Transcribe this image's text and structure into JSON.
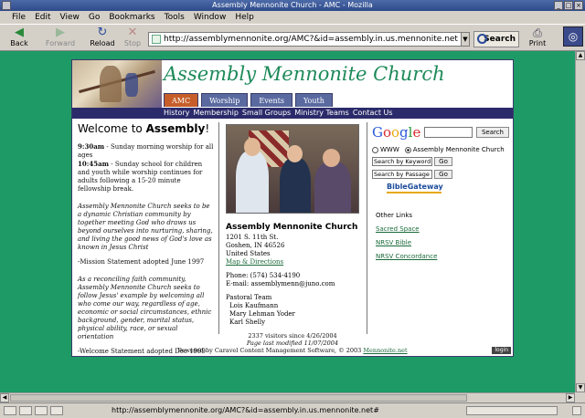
{
  "window": {
    "title": "Assembly Mennonite Church - AMC - Mozilla"
  },
  "menu": [
    "File",
    "Edit",
    "View",
    "Go",
    "Bookmarks",
    "Tools",
    "Window",
    "Help"
  ],
  "toolbar": {
    "back": "Back",
    "forward": "Forward",
    "reload": "Reload",
    "stop": "Stop",
    "url": "http://assemblymennonite.org/AMC?&id=assembly.in.us.mennonite.net",
    "search": "Search",
    "print": "Print"
  },
  "status": {
    "text": "http://assemblymennonite.org/AMC?&id=assembly.in.us.mennonite.net#"
  },
  "site": {
    "title": "Assembly Mennonite Church",
    "tabs": [
      "AMC",
      "Worship",
      "Events",
      "Youth"
    ],
    "subnav": [
      "History",
      "Membership",
      "Small Groups",
      "Ministry Teams",
      "Contact Us"
    ],
    "welcome_prefix": "Welcome to ",
    "welcome_bold": "Assembly",
    "welcome_suffix": "!",
    "schedule_time1": "9:30am",
    "schedule_text1": " - Sunday morning worship for all ages",
    "schedule_time2": "10:45am",
    "schedule_text2": " - Sunday school for children and youth while worship continues for adults following a 15-20 minute fellowship break.",
    "mission": "Assembly Mennonite Church seeks to be a dynamic Christian community by together meeting God who draws us beyond ourselves into nurturing, sharing, and living the good news of God's love as known in Jesus Christ",
    "mission_note": "-Mission Statement adopted June 1997",
    "welcome_statement": "As a reconciling faith community, Assembly Mennonite Church seeks to follow Jesus' example by welcoming all who come our way, regardless of age, economic or social circumstances, ethnic background, gender, marital status, physical ability, race, or sexual orientation",
    "welcome_note": "-Welcome Statement adopted Dec 1999",
    "church_name": "Assembly Mennonite Church",
    "addr1": "1201 S. 11th St.",
    "addr2": "Goshen, IN 46526",
    "addr3": "United States",
    "map_link": "Map & Directions",
    "phone": "Phone: (574) 534-4190",
    "email": "E-mail: assemblymenn@juno.com",
    "team_title": "Pastoral Team",
    "team": [
      "Lois Kaufmann",
      "Mary Lehman Yoder",
      "Karl Shelly"
    ],
    "search_btn": "Search",
    "radio_www": "WWW",
    "radio_site": "Assembly Mennonite Church",
    "bible_keyword": "Search by Keyword",
    "bible_passage": "Search by Passage",
    "go": "Go",
    "biblegateway": "BibleGateway",
    "other_links": "Other Links",
    "link1": "Sacred Space",
    "link2": "NRSV Bible",
    "link3": "NRSV Concordance",
    "footer1": "2337 visitors since 4/26/2004",
    "footer2": "Page last modified 11/07/2004",
    "footer3": "Powered by Caravel Content Management Software, © 2003",
    "footer3_link": "Mennonite.net",
    "login": "login"
  }
}
